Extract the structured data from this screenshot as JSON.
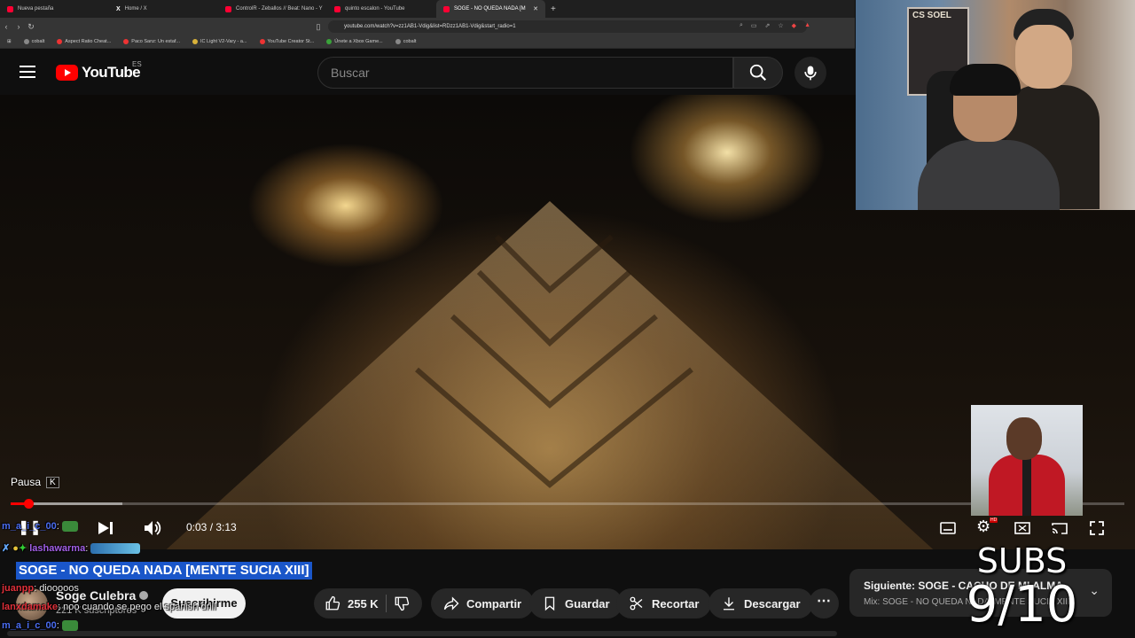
{
  "browser": {
    "tabs": [
      {
        "label": "Nueva pestaña",
        "active": false
      },
      {
        "label": "Home / X",
        "active": false
      },
      {
        "label": "ControlR - Zeballos // Beat: Nano - Y",
        "active": false
      },
      {
        "label": "quinto escalon - YouTube",
        "active": false
      },
      {
        "label": "SOGE - NO QUEDA NADA [M",
        "active": true
      }
    ],
    "url": "youtube.com/watch?v=zz1AB1-Vdig&list=RDzz1AB1-Vdig&start_radio=1",
    "bookmarks": [
      "cobalt",
      "Aspect Ratio Cheat...",
      "Paco Sanz: Un estaf...",
      "IC Light V2-Vary - a...",
      "YouTube Creator St...",
      "Únete a Xbox Game...",
      "cobalt"
    ]
  },
  "header": {
    "logo_text": "YouTube",
    "region": "ES",
    "search_placeholder": "Buscar"
  },
  "player": {
    "pause_tooltip": "Pausa",
    "pause_key": "K",
    "time_display": "0:03 / 3:13",
    "played_fraction": 0.016,
    "buffered_fraction": 0.1
  },
  "video": {
    "title": "SOGE - NO QUEDA NADA [MENTE SUCIA XIII]",
    "channel": "Soge Culebra",
    "subscribers": "221 K suscriptores",
    "subscribe_label": "Suscribirme",
    "likes": "255 K",
    "actions": {
      "share": "Compartir",
      "save": "Guardar",
      "clip": "Recortar",
      "download": "Descargar"
    }
  },
  "up_next": {
    "label": "Siguiente: SOGE - CACHO DE MI ALMA",
    "mix": "Mix: SOGE - NO QUEDA NADA [MENTE SUCIA XIII]"
  },
  "overlay_chat": [
    {
      "user": "m_a_i_c_00",
      "text": ""
    },
    {
      "user": "lashawarma",
      "text": ""
    },
    {
      "user": "juanpp",
      "text": "diooooos"
    },
    {
      "user": "lanxdamake",
      "text": "noo cuando se pego el spanish drill"
    },
    {
      "user": "m_a_i_c_00",
      "text": ""
    }
  ],
  "overlay_rating": {
    "label": "SUBS",
    "score": "9/10"
  },
  "colors": {
    "yt_red": "#ff0000",
    "background": "#0f0f0f",
    "title_highlight": "#1a56c9"
  }
}
